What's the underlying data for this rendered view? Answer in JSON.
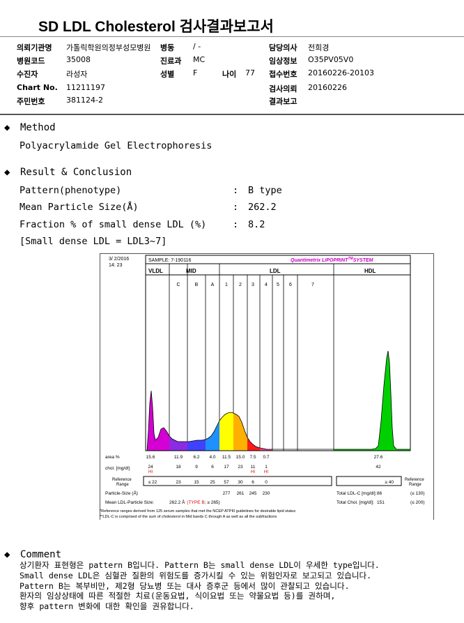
{
  "report": {
    "title": "SD LDL Cholesterol 검사결과보고서",
    "left": [
      {
        "label": "의뢰기관명",
        "value": "가톨릭학원의정부성모병원"
      },
      {
        "label": "병원코드",
        "value": "35008"
      },
      {
        "label": "수진자",
        "value": "라성자"
      },
      {
        "label": "Chart No.",
        "value": "11211197"
      },
      {
        "label": "주민번호",
        "value": "381124-2"
      }
    ],
    "mid": [
      {
        "label": "병동",
        "value": "/ -"
      },
      {
        "label": "진료과",
        "value": "MC"
      },
      {
        "label": "성별",
        "value": "F"
      }
    ],
    "age": {
      "label": "나이",
      "value": "77"
    },
    "right": [
      {
        "label": "담당의사",
        "value": "전희경"
      },
      {
        "label": "임상정보",
        "value": "O35PV05V0"
      },
      {
        "label": "접수번호",
        "value": "20160226-20103"
      },
      {
        "label": "검사의뢰",
        "value": "20160226"
      },
      {
        "label": "결과보고",
        "value": ""
      }
    ]
  },
  "method": {
    "bullet": "◆",
    "heading": "Method",
    "text": "Polyacrylamide Gel Electrophoresis"
  },
  "result": {
    "bullet": "◆",
    "heading": "Result & Conclusion",
    "rows": [
      {
        "label": "Pattern(phenotype)",
        "colon": ":",
        "value": "B type"
      },
      {
        "label": "Mean Particle Size(Å)",
        "colon": ":",
        "value": "262.2"
      },
      {
        "label": "Fraction % of small dense LDL (%)",
        "colon": ":",
        "value": "8.2"
      }
    ],
    "note": "[Small dense LDL = LDL3~7]"
  },
  "chart_data": {
    "type": "area",
    "date": "3/ 2/2016",
    "time": "14: 23",
    "sample": "SAMPLE:  7-190116",
    "brand": "Quantimetrix LIPOPRINT",
    "brand_tm": "TM",
    "brand_suffix": "SYSTEM",
    "groups": [
      "VLDL",
      "MID",
      "LDL",
      "HDL"
    ],
    "bands": [
      "C",
      "B",
      "A",
      "1",
      "2",
      "3",
      "4",
      "5",
      "6",
      "7"
    ],
    "area_label": "area %",
    "area": [
      "15.6",
      "11.9",
      "6.2",
      "4.0",
      "11.5",
      "15.0",
      "7.5",
      "0.7",
      "27.6"
    ],
    "chol_label": "chol. [mg/dl]",
    "chol": [
      "24",
      "18",
      "9",
      "6",
      "17",
      "23",
      "11",
      "1",
      "42"
    ],
    "hi_flags": [
      "HI",
      "HI",
      "HI"
    ],
    "ref_label": "Reference",
    "ref_label2": "Range",
    "ref_values": [
      "≤ 22",
      "23",
      "15",
      "25",
      "57",
      "30",
      "6",
      "0"
    ],
    "hdl_ref": "≥ 40",
    "ref_right": "Reference",
    "ref_right2": "Range",
    "particle_size_label": "Particle-Size (Å)",
    "particle_sizes": [
      "277",
      "261",
      "245",
      "230"
    ],
    "mean_label": "Mean LDL-Particle Size:",
    "mean_value": "262.2 Å",
    "mean_type": "(TYPE B",
    "mean_limit": "; ≥ 265)",
    "total_ldl_label": "Total LDL-C [mg/dl]:",
    "total_ldl": "86",
    "total_ldl_ref": "(≤ 130)",
    "total_chol_label": "Total Chol. [mg/dl]:",
    "total_chol": "151",
    "total_chol_ref": "(≤ 200)",
    "footnote1": "*Reference ranges derived from 125 serum samples that met the NCEP ATPIII guidelines for desirable lipid status",
    "footnote2": "**LDL-C is comprised of the sum of cholesterol in Mid bands C through A as well as all the subfractions",
    "colors": {
      "vldl": "#d400d4",
      "mid": "#4040ff",
      "midA": "#1e90ff",
      "ldl1": "#ffff00",
      "ldl2": "#ffb000",
      "ldl3": "#ff1a1a",
      "ldl4": "#ff3c8c",
      "hdl": "#00d000",
      "brand": "#c800c8",
      "hi": "#e00000",
      "type": "#e00000"
    }
  },
  "comment": {
    "bullet": "◆",
    "heading": "Comment",
    "lines": [
      "상기환자 표현형은 pattern B입니다. Pattern B는 small dense LDL이 우세한 type입니다.",
      "Small dense LDL은 심혈관 질환의 위험도를 증가시킬 수 있는 위험인자로 보고되고 있습니다.",
      "Pattern B는 복부비만, 제2형 당뇨병 또는 대사 증후군 등에서 많이 관찰되고 있습니다.",
      "환자의 임상상태에 따른 적절한 치료(운동요법, 식이요법 또는 약물요법 등)를 권하며,",
      "향후 pattern 변화에 대한 확인을 권유합니다."
    ]
  }
}
